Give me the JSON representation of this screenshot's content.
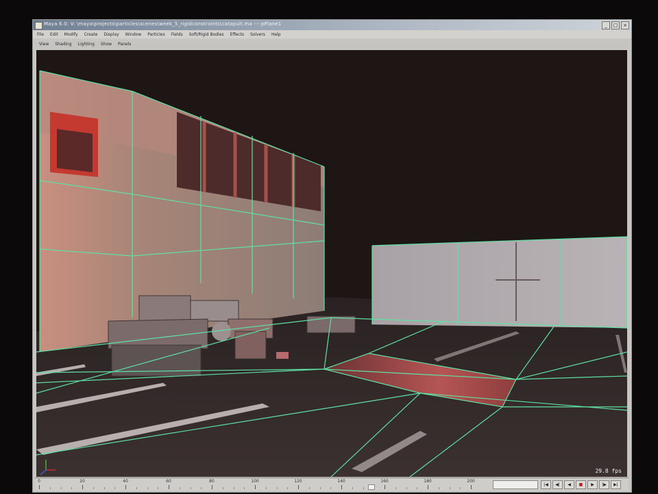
{
  "window": {
    "title": "Maya 6.0: V: \\maya\\projects\\particles\\scenes\\week_5_rigidconstraints\\catapult.ma --- pPlane1",
    "buttons": {
      "minimize": "_",
      "maximize": "□",
      "close": "×"
    }
  },
  "menu": [
    "File",
    "Edit",
    "Modify",
    "Create",
    "Display",
    "Window",
    "Particles",
    "Fields",
    "Soft/Rigid Bodies",
    "Effects",
    "Solvers",
    "Help"
  ],
  "panel_menu": [
    "View",
    "Shading",
    "Lighting",
    "Show",
    "Panels"
  ],
  "viewport": {
    "fps": "29.8 fps",
    "wireframe_color": "#5fe0a4",
    "background_color": "#1e1615"
  },
  "timeline": {
    "ticks": [
      "0",
      "20",
      "40",
      "60",
      "80",
      "100",
      "120",
      "140",
      "160",
      "180",
      "200"
    ],
    "current_frame_position": 0.77
  },
  "playback": {
    "buttons": [
      {
        "name": "go-to-start",
        "glyph": "|◀"
      },
      {
        "name": "step-back",
        "glyph": "◀|"
      },
      {
        "name": "play-back",
        "glyph": "◀"
      },
      {
        "name": "stop",
        "glyph": "■"
      },
      {
        "name": "play-forward",
        "glyph": "▶"
      },
      {
        "name": "step-forward",
        "glyph": "|▶"
      },
      {
        "name": "go-to-end",
        "glyph": "▶|"
      }
    ]
  }
}
